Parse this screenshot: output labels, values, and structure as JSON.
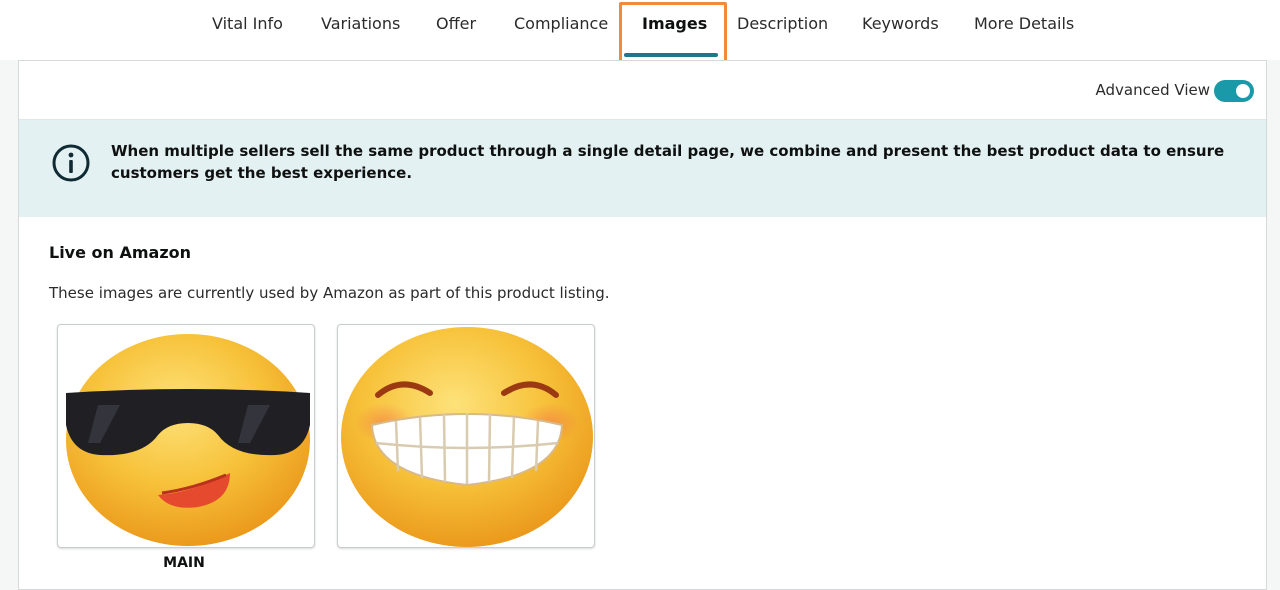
{
  "tabs": [
    {
      "label": "Vital Info"
    },
    {
      "label": "Variations"
    },
    {
      "label": "Offer"
    },
    {
      "label": "Compliance"
    },
    {
      "label": "Images",
      "active": true
    },
    {
      "label": "Description"
    },
    {
      "label": "Keywords"
    },
    {
      "label": "More Details"
    }
  ],
  "toolbar": {
    "advanced_view_label": "Advanced View",
    "advanced_view_on": true
  },
  "info_banner": {
    "icon": "info-circle-icon",
    "text": "When multiple sellers sell the same product through a single detail page, we combine and present the best product data to ensure customers get the best experience."
  },
  "live_section": {
    "title": "Live on Amazon",
    "description": "These images are currently used by Amazon as part of this product listing.",
    "images": [
      {
        "label": "MAIN",
        "icon": "sunglasses-emoji-icon"
      },
      {
        "label": "",
        "icon": "grinning-emoji-icon"
      }
    ]
  },
  "colors": {
    "accent": "#1a7a8a",
    "toggle": "#1a9aa8",
    "highlight": "#f08a3c",
    "banner": "#e3f1f2"
  }
}
